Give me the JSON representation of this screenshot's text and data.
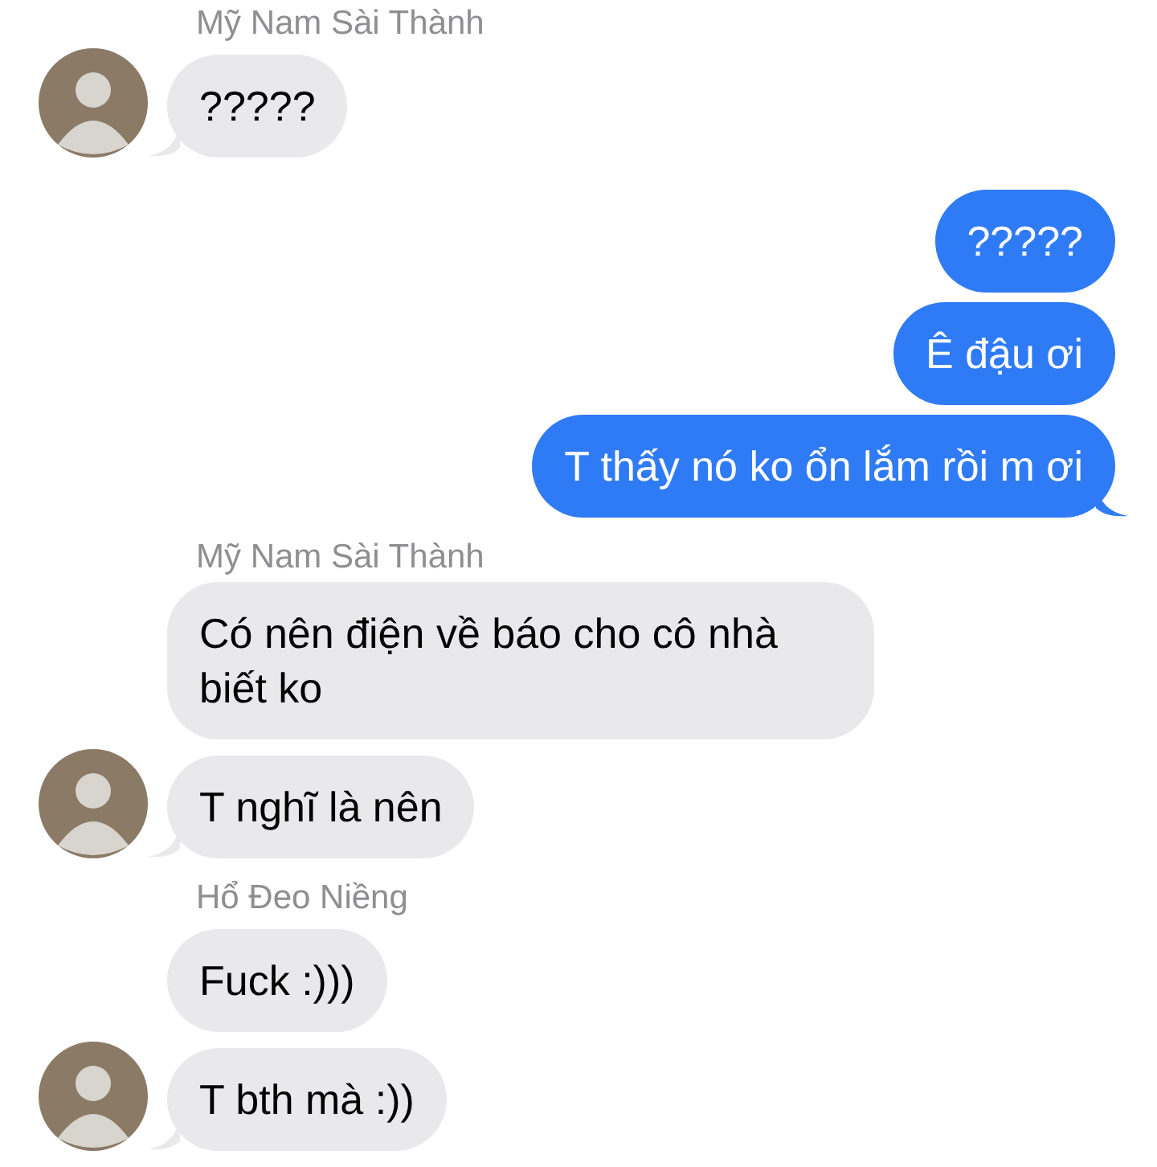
{
  "messages": [
    {
      "kind": "sender",
      "text": "Mỹ Nam Sài Thành"
    },
    {
      "kind": "incoming",
      "text": "?????",
      "avatar": true,
      "tail": true
    },
    {
      "kind": "outgoing",
      "text": "?????",
      "tail": false
    },
    {
      "kind": "outgoing",
      "text": "Ê đậu ơi",
      "tail": false
    },
    {
      "kind": "outgoing",
      "text": "T thấy nó ko ổn lắm rồi m ơi",
      "tail": true
    },
    {
      "kind": "sender",
      "text": "Mỹ Nam Sài Thành"
    },
    {
      "kind": "incoming",
      "text": "Có nên điện về báo cho cô nhà biết ko",
      "avatar": false,
      "tail": false
    },
    {
      "kind": "incoming",
      "text": "T nghĩ là nên",
      "avatar": true,
      "tail": true
    },
    {
      "kind": "sender",
      "text": "Hổ Đeo Niềng"
    },
    {
      "kind": "incoming",
      "text": "Fuck :)))",
      "avatar": false,
      "tail": false
    },
    {
      "kind": "incoming",
      "text": "T bth mà :))",
      "avatar": true,
      "tail": true
    }
  ]
}
